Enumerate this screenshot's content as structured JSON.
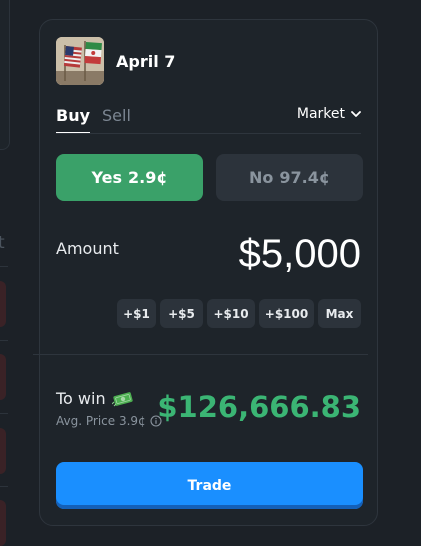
{
  "market": {
    "title": "April 7",
    "image_icon": "us-iran-flags-image"
  },
  "tabs": [
    {
      "label": "Buy",
      "active": true
    },
    {
      "label": "Sell",
      "active": false
    }
  ],
  "order_type": {
    "selected": "Market",
    "icon": "chevron-down-icon"
  },
  "outcomes": {
    "yes": {
      "label": "Yes",
      "price": "2.9¢",
      "selected": true
    },
    "no": {
      "label": "No",
      "price": "97.4¢",
      "selected": false
    }
  },
  "amount": {
    "label": "Amount",
    "value": "$5,000"
  },
  "quick_add": [
    "+$1",
    "+$5",
    "+$10",
    "+$100",
    "Max"
  ],
  "to_win": {
    "label": "To win",
    "icon": "money-icon",
    "avg_price": "Avg. Price 3.9¢",
    "value": "$126,666.83"
  },
  "trade_button": "Trade",
  "background": {
    "partial_letter": "t"
  },
  "colors": {
    "background": "#1c2127",
    "card": "#1e242a",
    "yes_green": "#3aa169",
    "payout_green": "#3bb574",
    "trade_blue": "#1a8fff"
  }
}
